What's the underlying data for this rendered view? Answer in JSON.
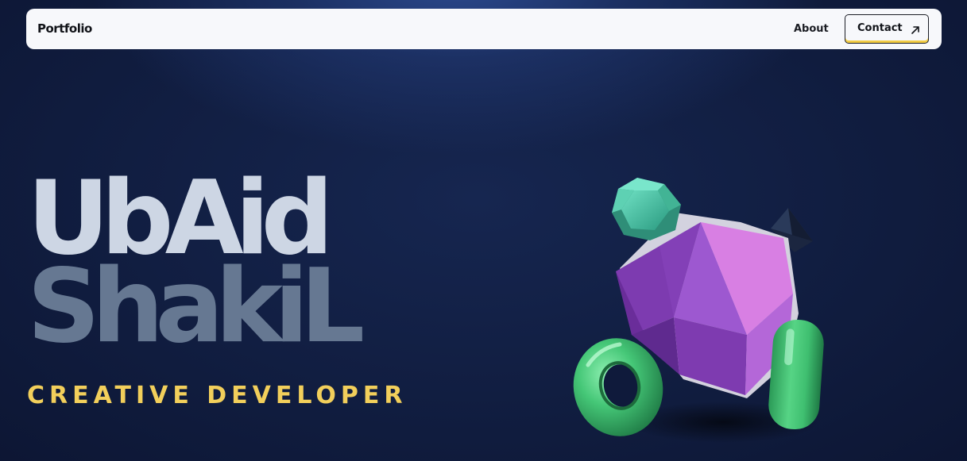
{
  "navbar": {
    "brand": "Portfolio",
    "about_label": "About",
    "contact_label": "Contact",
    "contact_icon": "arrow-up-right-icon"
  },
  "hero": {
    "first_name": "UbAid",
    "last_name": "ShakiL",
    "subtitle": "CREATIVE DEVELOPER"
  },
  "art": {
    "description_icon": "3d-shapes-illustration",
    "colors": {
      "icosahedron": "#9b55c9",
      "dodecahedron": "#4fc3a8",
      "torus": "#3ec06e",
      "pill": "#3ec06e",
      "pyramid": "#1e2a44"
    }
  },
  "colors": {
    "background": "#0f1a3b",
    "navbar_bg": "#f7f8fb",
    "name_first": "#cdd6e4",
    "name_last": "#667892",
    "accent_yellow": "#f2cf5b"
  }
}
